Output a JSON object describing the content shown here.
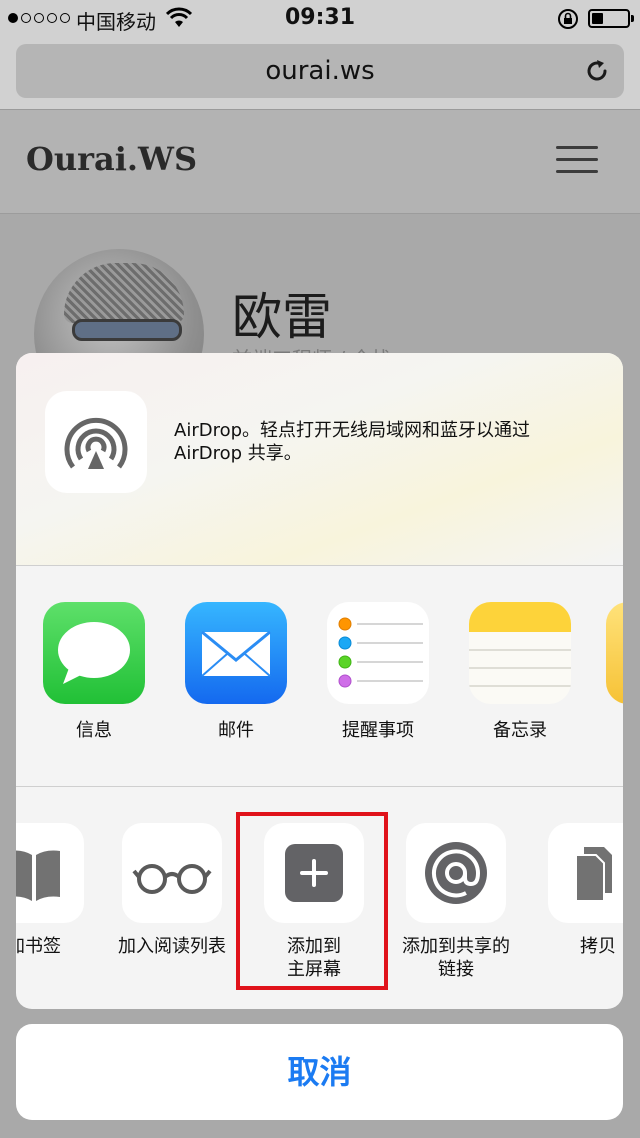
{
  "status_bar": {
    "carrier": "中国移动",
    "time": "09:31"
  },
  "browser": {
    "url": "ourai.ws"
  },
  "site": {
    "logo": "Ourai.WS",
    "author_name": "欧雷",
    "author_subtitle": "前端工程师 / 全栈 ..."
  },
  "share_sheet": {
    "airdrop_text": "AirDrop。轻点打开无线局域网和蓝牙以通过 AirDrop 共享。",
    "apps": [
      {
        "label": "信息",
        "icon": "messages-icon",
        "color": "#34c759"
      },
      {
        "label": "邮件",
        "icon": "mail-icon",
        "color": "#1a8cf0"
      },
      {
        "label": "提醒事项",
        "icon": "reminders-icon",
        "color": "#ffffff"
      },
      {
        "label": "备忘录",
        "icon": "notes-icon",
        "color": "#fdd33a"
      }
    ],
    "actions": [
      {
        "label": "加书签",
        "icon": "book-icon"
      },
      {
        "label": "加入阅读列表",
        "icon": "glasses-icon"
      },
      {
        "label": "添加到\n主屏幕",
        "icon": "add-square-icon"
      },
      {
        "label": "添加到共享的\n链接",
        "icon": "at-sign-icon"
      },
      {
        "label": "拷贝",
        "icon": "copy-icon"
      }
    ],
    "cancel": "取消"
  },
  "colors": {
    "accent": "#1b7bf2",
    "highlight": "#e0131b"
  }
}
